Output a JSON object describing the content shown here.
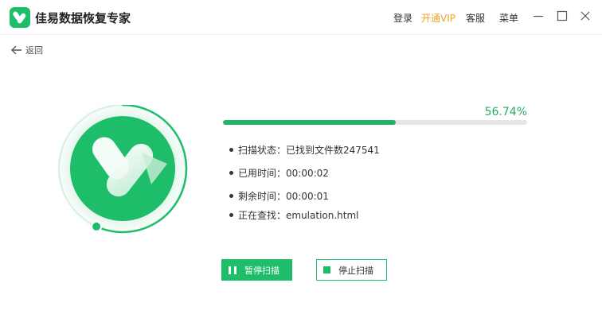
{
  "app": {
    "title": "佳易数据恢复专家",
    "logo_icon": "app-logo-icon"
  },
  "top_menu": {
    "login": "登录",
    "vip": "开通VIP",
    "service": "客服",
    "menu": "菜单"
  },
  "window_controls": [
    "minimize-icon",
    "maximize-icon",
    "close-icon"
  ],
  "back": {
    "label": "返回",
    "icon": "arrow-left-icon"
  },
  "scan": {
    "percent_text": "56.74%",
    "progress": 0.5674,
    "status": "扫描状态：已找到文件数247541",
    "elapsed": "已用时间：00:00:02",
    "remaining": "剩余时间：00:00:01",
    "searching": "正在查找：emulation.html"
  },
  "buttons": {
    "pause_label": "暂停扫描",
    "stop_label": "停止扫描"
  },
  "colors": {
    "accent": "#1ebd6a",
    "vip": "#f0a020",
    "progress_track": "#e6e6e6"
  }
}
